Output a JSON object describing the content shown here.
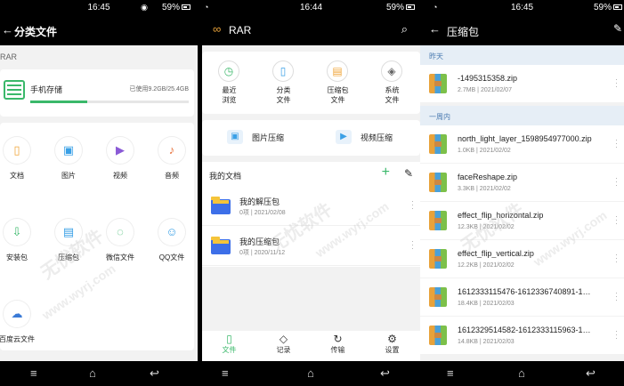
{
  "panel1": {
    "time": "16:45",
    "battery": "59%",
    "title": "分类文件",
    "section": "RAR",
    "storage": {
      "name": "手机存储",
      "usage": "已使用9.2GB/25.4GB",
      "used_fraction": 0.36
    },
    "categories": [
      {
        "label": "文档",
        "icon": "document-icon",
        "color": "#f0a53a"
      },
      {
        "label": "图片",
        "icon": "image-icon",
        "color": "#3aa0e6"
      },
      {
        "label": "视频",
        "icon": "video-icon",
        "color": "#8a5ad6"
      },
      {
        "label": "音频",
        "icon": "audio-icon",
        "color": "#e8703a"
      },
      {
        "label": "安装包",
        "icon": "apk-icon",
        "color": "#3ab86a"
      },
      {
        "label": "压缩包",
        "icon": "zip-icon",
        "color": "#3aa0e6"
      },
      {
        "label": "微信文件",
        "icon": "wechat-icon",
        "color": "#3ab86a"
      },
      {
        "label": "QQ文件",
        "icon": "qq-icon",
        "color": "#3aa0e6"
      },
      {
        "label": "百度云文件",
        "icon": "baidu-cloud-icon",
        "color": "#3a7ad6"
      }
    ]
  },
  "panel2": {
    "time": "16:44",
    "battery": "59%",
    "title": "RAR",
    "quick": [
      {
        "label": "最近\n浏览",
        "icon": "clock-icon",
        "color": "#3ab86a"
      },
      {
        "label": "分类\n文件",
        "icon": "file-icon",
        "color": "#3aa0e6"
      },
      {
        "label": "压缩包\n文件",
        "icon": "zip-icon",
        "color": "#f0a53a"
      },
      {
        "label": "系统\n文件",
        "icon": "layers-icon",
        "color": "#666666"
      }
    ],
    "tools": [
      {
        "label": "图片压缩",
        "icon": "image-compress-icon"
      },
      {
        "label": "视频压缩",
        "icon": "video-compress-icon"
      }
    ],
    "docs_title": "我的文档",
    "folders": [
      {
        "name": "我的解压包",
        "meta": "0项 | 2021/02/08"
      },
      {
        "name": "我的压缩包",
        "meta": "0项 | 2020/11/12"
      }
    ],
    "tabs": [
      {
        "label": "文件",
        "icon": "file-tab-icon",
        "active": true
      },
      {
        "label": "记录",
        "icon": "record-tab-icon",
        "active": false
      },
      {
        "label": "传输",
        "icon": "transfer-tab-icon",
        "active": false
      },
      {
        "label": "设置",
        "icon": "settings-tab-icon",
        "active": false
      }
    ],
    "accent": "#3ab86a"
  },
  "panel3": {
    "time": "16:45",
    "battery": "59%",
    "title": "压缩包",
    "section_yesterday": "昨天",
    "section_week": "一周内",
    "files": [
      {
        "name": "-1495315358.zip",
        "meta": "2.7MB | 2021/02/07"
      },
      {
        "name": "north_light_layer_1598954977000.zip",
        "meta": "1.0KB | 2021/02/02"
      },
      {
        "name": "faceReshape.zip",
        "meta": "3.3KB | 2021/02/02"
      },
      {
        "name": "effect_flip_horizontal.zip",
        "meta": "12.3KB | 2021/02/02"
      },
      {
        "name": "effect_flip_vertical.zip",
        "meta": "12.2KB | 2021/02/02"
      },
      {
        "name": "1612333115476-1612336740891-1…",
        "meta": "18.4KB | 2021/02/03"
      },
      {
        "name": "1612329514582-1612333115963-1…",
        "meta": "14.8KB | 2021/02/03"
      }
    ]
  },
  "watermark": {
    "cn": "无忧软件",
    "url": "www.wyrj.com"
  }
}
